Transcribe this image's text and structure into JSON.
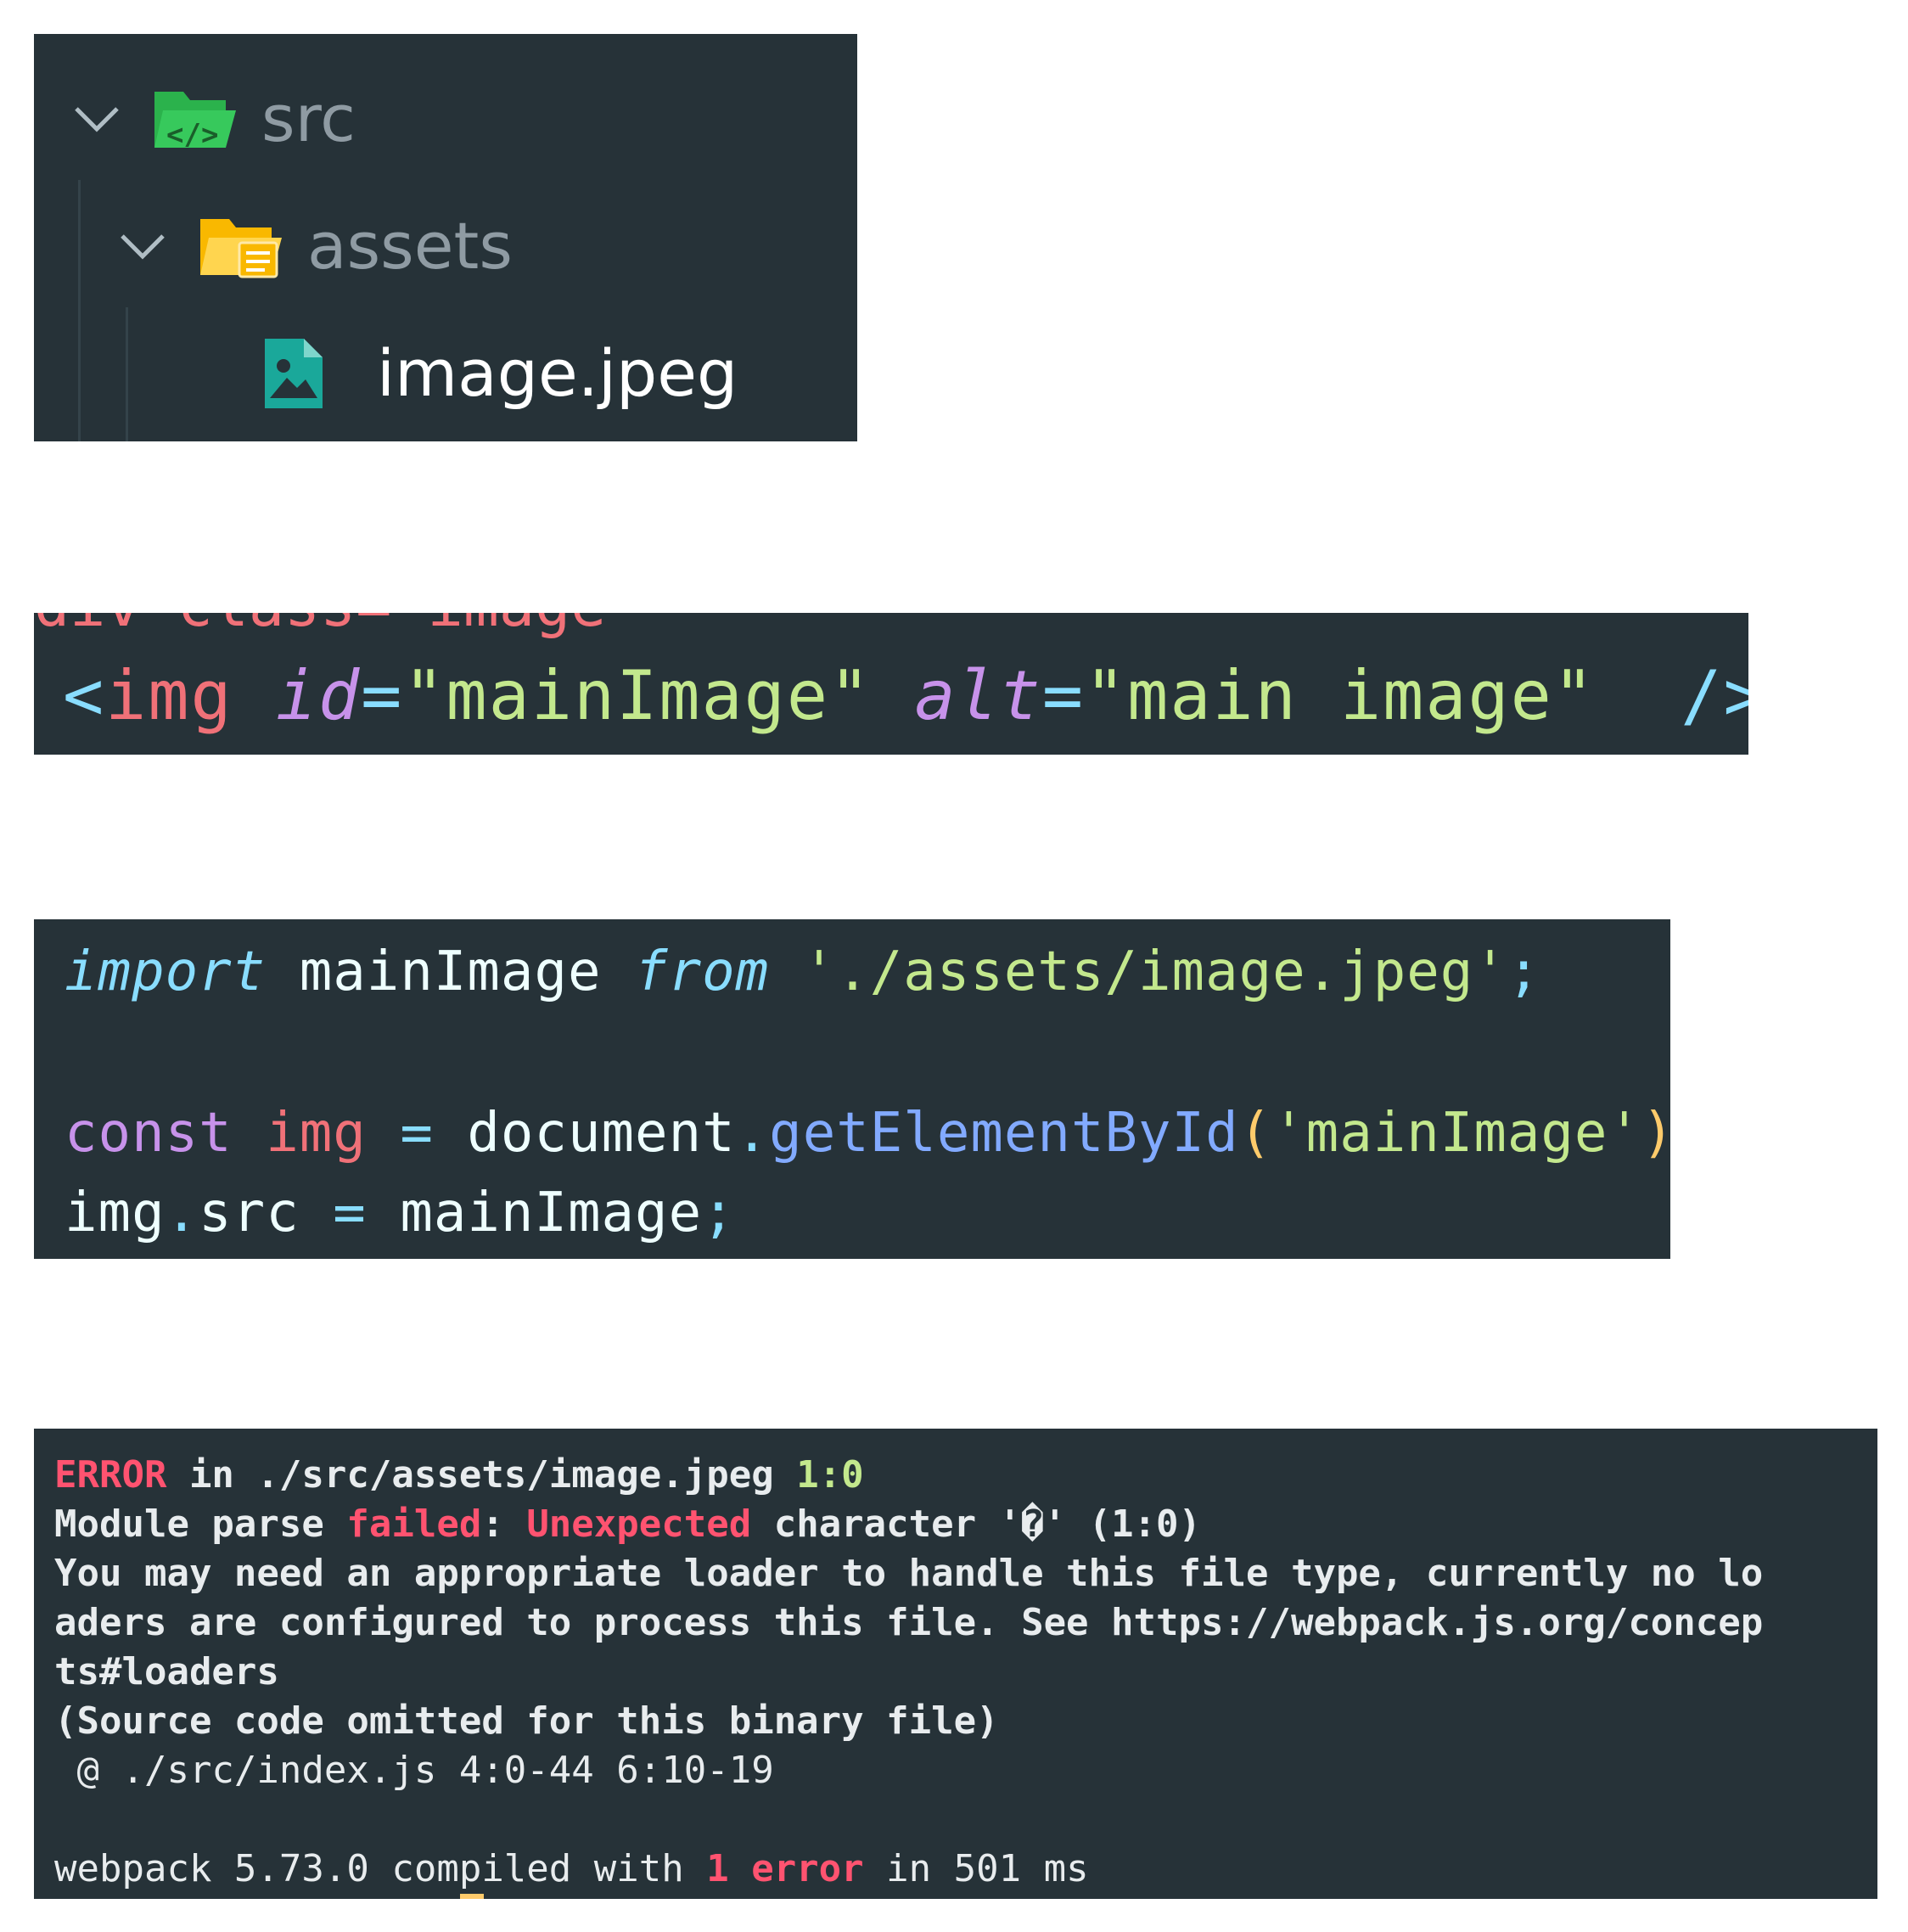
{
  "file_tree": {
    "items": [
      {
        "label": "src",
        "type": "folder",
        "expanded": true,
        "icon": "source-folder-icon",
        "color": "#2bb24c"
      },
      {
        "label": "assets",
        "type": "folder",
        "expanded": true,
        "icon": "assets-folder-icon",
        "color": "#f9b800"
      },
      {
        "label": "image.jpeg",
        "type": "file",
        "icon": "image-file-icon",
        "color": "#1aa89a"
      }
    ]
  },
  "html_snippet": {
    "clipped_previous_line": "div class=\"image\"",
    "tokens": {
      "open": "<",
      "tag": "img",
      "attr1": "id",
      "eq1": "=",
      "val1": "\"mainImage\"",
      "attr2": "alt",
      "eq2": "=",
      "val2": "\"main image\"",
      "close": "/>"
    }
  },
  "js_snippet": {
    "line1": {
      "kw_import": "import",
      "ident": "mainImage",
      "kw_from": "from",
      "path": "'./assets/image.jpeg'",
      "semi": ";"
    },
    "line2": {
      "kw_const": "const",
      "var": "img",
      "eq": "=",
      "obj": "document",
      "dot": ".",
      "method": "getElementById",
      "lparen": "(",
      "arg": "'mainImage'",
      "rparen": ")",
      "semi": ";"
    },
    "line3": {
      "obj": "img",
      "dot": ".",
      "prop": "src",
      "eq": "=",
      "value": "mainImage",
      "semi": ";"
    }
  },
  "terminal": {
    "line1": {
      "error": "ERROR",
      "text": " in ./src/assets/image.jpeg ",
      "pos": "1:0"
    },
    "line2": {
      "a": "Module parse ",
      "failed": "failed",
      "b": ": ",
      "unexpected": "Unexpected",
      "c": " character '�' (1:0)"
    },
    "line3": "You may need an appropriate loader to handle this file type, currently no lo",
    "line4": "aders are configured to process this file. See https://webpack.js.org/concep",
    "line5": "ts#loaders",
    "line6": "(Source code omitted for this binary file)",
    "line7": " @ ./src/index.js 4:0-44 6:10-19",
    "line9": {
      "a": "webpack 5.73.0 compiled with ",
      "count": "1 error",
      "b": " in 501 ms"
    }
  },
  "colors": {
    "panel_bg": "#263238",
    "error_red": "#ff5370",
    "string_green": "#c3e88d",
    "keyword_cyan": "#89ddff",
    "attr_purple": "#c792ea",
    "function_blue": "#82aaff"
  }
}
